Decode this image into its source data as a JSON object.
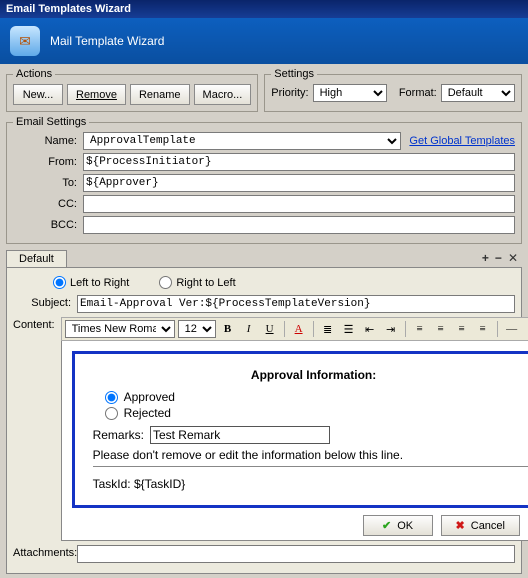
{
  "window": {
    "title": "Email Templates Wizard"
  },
  "header": {
    "title": "Mail Template Wizard"
  },
  "actions": {
    "legend": "Actions",
    "new": "New...",
    "remove": "Remove",
    "rename": "Rename",
    "macro": "Macro..."
  },
  "settings": {
    "legend": "Settings",
    "priority_label": "Priority:",
    "priority_value": "High",
    "format_label": "Format:",
    "format_value": "Default"
  },
  "email": {
    "legend": "Email Settings",
    "name_label": "Name:",
    "name_value": "ApprovalTemplate",
    "from_label": "From:",
    "from_value": "${ProcessInitiator}",
    "to_label": "To:",
    "to_value": "${Approver}",
    "cc_label": "CC:",
    "cc_value": "",
    "bcc_label": "BCC:",
    "bcc_value": "",
    "global_link": "Get Global Templates"
  },
  "tab": {
    "default": "Default",
    "ltr": "Left to Right",
    "rtl": "Right to Left"
  },
  "subject": {
    "label": "Subject:",
    "value": "Email-Approval Ver:${ProcessTemplateVersion}"
  },
  "contentLabel": "Content:",
  "editor": {
    "font": "Times New Roman",
    "size": "12"
  },
  "body": {
    "heading": "Approval Information:",
    "approved": "Approved",
    "rejected": "Rejected",
    "remarks_label": "Remarks:",
    "remarks_value": "Test Remark",
    "noedit": "Please don't remove or edit the  information below this line.",
    "taskid": "TaskId: ${TaskID}"
  },
  "attachments": {
    "label": "Attachments:",
    "value": ""
  },
  "footer": {
    "ok": "OK",
    "cancel": "Cancel"
  }
}
